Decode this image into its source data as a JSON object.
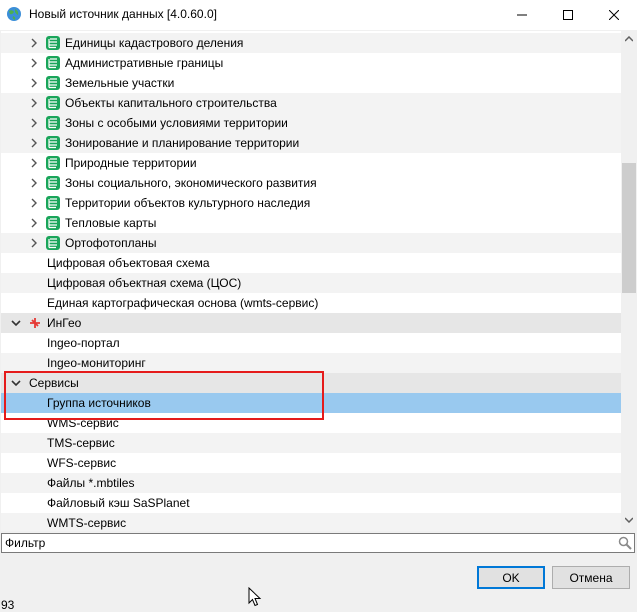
{
  "window": {
    "title": "Новый источник данных [4.0.60.0]"
  },
  "tree": {
    "layer_items": [
      "Единицы кадастрового деления",
      "Административные границы",
      "Земельные участки",
      "Объекты капитального строительства",
      "Зоны с особыми условиями территории",
      "Зонирование и планирование территории",
      "Природные территории",
      "Зоны социального, экономического развития",
      "Территории объектов культурного наследия",
      "Тепловые карты",
      "Ортофотопланы"
    ],
    "plain_items": [
      "Цифровая объектовая схема",
      "Цифровая объектная схема (ЦОС)",
      "Единая картографическая основа (wmts-сервис)"
    ],
    "ingeo_group": "ИнГео",
    "ingeo_items": [
      "Ingeo-портал",
      "Ingeo-мониторинг"
    ],
    "services_group": "Сервисы",
    "services_items": [
      "Группа источников",
      "WMS-сервис",
      "TMS-сервис",
      "WFS-сервис",
      "Файлы *.mbtiles",
      "Файловый кэш SaSPlanet",
      "WMTS-сервис"
    ]
  },
  "filter": {
    "placeholder": "Фильтр",
    "value": ""
  },
  "buttons": {
    "ok": "OK",
    "cancel": "Отмена"
  },
  "status": {
    "count": "93"
  },
  "colors": {
    "selection": "#99c9ef",
    "layer_icon": "#1aa55a",
    "highlight_frame": "#e51b1b",
    "ok_border": "#0078d7"
  },
  "icons": {
    "app": "globe-icon",
    "layer": "layers-icon",
    "ingeo": "ingeo-icon",
    "expand": "chevron-right-icon",
    "collapse": "chevron-down-icon",
    "search": "search-icon"
  }
}
